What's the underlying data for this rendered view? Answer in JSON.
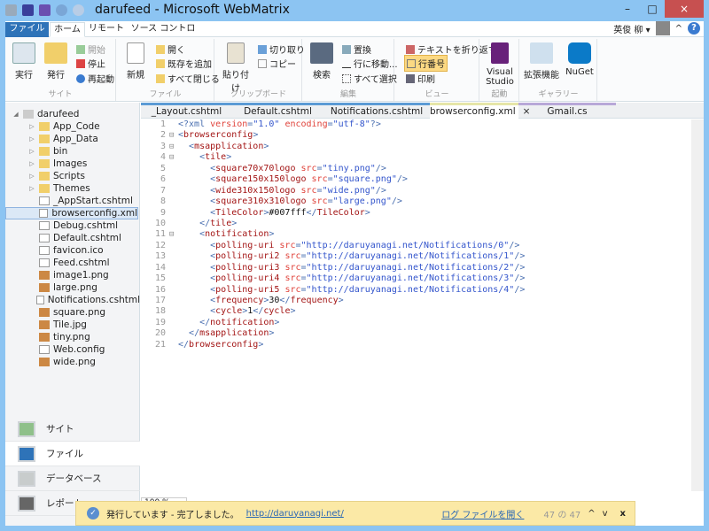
{
  "window": {
    "title": "darufeed - Microsoft WebMatrix",
    "minimize": "–",
    "maximize": "□",
    "close": "×"
  },
  "ribbon_tabs": [
    "ファイル",
    "ホーム",
    "リモート",
    "ソース コントロール"
  ],
  "user": {
    "name": "英俊 柳 ▾",
    "collapse": "^",
    "help": "?"
  },
  "ribbon": {
    "site": {
      "label": "サイト",
      "run": "実行",
      "publish": "発行",
      "start": "開始",
      "stop": "停止",
      "restart": "再起動"
    },
    "file": {
      "label": "ファイル",
      "new": "新規",
      "open": "開く",
      "add_existing": "既存を追加",
      "close_all": "すべて閉じる"
    },
    "clipboard": {
      "label": "クリップボード",
      "paste": "貼り付け",
      "cut": "切り取り",
      "copy": "コピー"
    },
    "edit": {
      "label": "編集",
      "find": "検索",
      "replace": "置換",
      "goto": "行に移動...",
      "select_all": "すべて選択"
    },
    "view": {
      "label": "ビュー",
      "wrap": "テキストを折り返す",
      "line_numbers": "行番号",
      "print": "印刷"
    },
    "launch": {
      "label": "起動",
      "vs": "Visual Studio"
    },
    "gallery": {
      "label": "ギャラリー",
      "extensions": "拡張機能",
      "nuget": "NuGet"
    }
  },
  "tree": [
    {
      "name": "darufeed",
      "type": "root"
    },
    {
      "name": "App_Code",
      "type": "folder"
    },
    {
      "name": "App_Data",
      "type": "folder"
    },
    {
      "name": "bin",
      "type": "folder"
    },
    {
      "name": "Images",
      "type": "folder"
    },
    {
      "name": "Scripts",
      "type": "folder"
    },
    {
      "name": "Themes",
      "type": "folder"
    },
    {
      "name": "_AppStart.cshtml",
      "type": "file"
    },
    {
      "name": "browserconfig.xml",
      "type": "file",
      "selected": true
    },
    {
      "name": "Debug.cshtml",
      "type": "file"
    },
    {
      "name": "Default.cshtml",
      "type": "file"
    },
    {
      "name": "favicon.ico",
      "type": "file"
    },
    {
      "name": "Feed.cshtml",
      "type": "file"
    },
    {
      "name": "image1.png",
      "type": "image"
    },
    {
      "name": "large.png",
      "type": "image"
    },
    {
      "name": "Notifications.cshtml",
      "type": "file"
    },
    {
      "name": "square.png",
      "type": "image"
    },
    {
      "name": "Tile.jpg",
      "type": "image"
    },
    {
      "name": "tiny.png",
      "type": "image"
    },
    {
      "name": "Web.config",
      "type": "file"
    },
    {
      "name": "wide.png",
      "type": "image"
    }
  ],
  "workspaces": [
    {
      "label": "サイト",
      "color": "#8fc08a"
    },
    {
      "label": "ファイル",
      "color": "#2e73b8",
      "active": true
    },
    {
      "label": "データベース",
      "color": "#c8cccc"
    },
    {
      "label": "レポート",
      "color": "#666"
    }
  ],
  "editor_tabs": [
    {
      "label": "_Layout.cshtml"
    },
    {
      "label": "Default.cshtml"
    },
    {
      "label": "Notifications.cshtml"
    },
    {
      "label": "browserconfig.xml",
      "active": true,
      "close": "×"
    },
    {
      "label": "Gmail.cs"
    }
  ],
  "code": [
    [
      [
        "b",
        "<?xml "
      ],
      [
        "a",
        "version"
      ],
      [
        "b",
        "="
      ],
      [
        "v",
        "\"1.0\" "
      ],
      [
        "a",
        "encoding"
      ],
      [
        "b",
        "="
      ],
      [
        "v",
        "\"utf-8\""
      ],
      [
        "b",
        "?>"
      ]
    ],
    [
      [
        "b",
        "<"
      ],
      [
        "t",
        "browserconfig"
      ],
      [
        "b",
        ">"
      ]
    ],
    [
      [
        "x",
        "  "
      ],
      [
        "b",
        "<"
      ],
      [
        "t",
        "msapplication"
      ],
      [
        "b",
        ">"
      ]
    ],
    [
      [
        "x",
        "    "
      ],
      [
        "b",
        "<"
      ],
      [
        "t",
        "tile"
      ],
      [
        "b",
        ">"
      ]
    ],
    [
      [
        "x",
        "      "
      ],
      [
        "b",
        "<"
      ],
      [
        "t",
        "square70x70logo "
      ],
      [
        "a",
        "src"
      ],
      [
        "b",
        "="
      ],
      [
        "v",
        "\"tiny.png\""
      ],
      [
        "b",
        "/>"
      ]
    ],
    [
      [
        "x",
        "      "
      ],
      [
        "b",
        "<"
      ],
      [
        "t",
        "square150x150logo "
      ],
      [
        "a",
        "src"
      ],
      [
        "b",
        "="
      ],
      [
        "v",
        "\"square.png\""
      ],
      [
        "b",
        "/>"
      ]
    ],
    [
      [
        "x",
        "      "
      ],
      [
        "b",
        "<"
      ],
      [
        "t",
        "wide310x150logo "
      ],
      [
        "a",
        "src"
      ],
      [
        "b",
        "="
      ],
      [
        "v",
        "\"wide.png\""
      ],
      [
        "b",
        "/>"
      ]
    ],
    [
      [
        "x",
        "      "
      ],
      [
        "b",
        "<"
      ],
      [
        "t",
        "square310x310logo "
      ],
      [
        "a",
        "src"
      ],
      [
        "b",
        "="
      ],
      [
        "v",
        "\"large.png\""
      ],
      [
        "b",
        "/>"
      ]
    ],
    [
      [
        "x",
        "      "
      ],
      [
        "b",
        "<"
      ],
      [
        "t",
        "TileColor"
      ],
      [
        "b",
        ">"
      ],
      [
        "x",
        "#007fff"
      ],
      [
        "b",
        "</"
      ],
      [
        "t",
        "TileColor"
      ],
      [
        "b",
        ">"
      ]
    ],
    [
      [
        "x",
        "    "
      ],
      [
        "b",
        "</"
      ],
      [
        "t",
        "tile"
      ],
      [
        "b",
        ">"
      ]
    ],
    [
      [
        "x",
        "    "
      ],
      [
        "b",
        "<"
      ],
      [
        "t",
        "notification"
      ],
      [
        "b",
        ">"
      ]
    ],
    [
      [
        "x",
        "      "
      ],
      [
        "b",
        "<"
      ],
      [
        "t",
        "polling-uri "
      ],
      [
        "a",
        "src"
      ],
      [
        "b",
        "="
      ],
      [
        "v",
        "\"http://daruyanagi.net/Notifications/0\""
      ],
      [
        "b",
        "/>"
      ]
    ],
    [
      [
        "x",
        "      "
      ],
      [
        "b",
        "<"
      ],
      [
        "t",
        "polling-uri2 "
      ],
      [
        "a",
        "src"
      ],
      [
        "b",
        "="
      ],
      [
        "v",
        "\"http://daruyanagi.net/Notifications/1\""
      ],
      [
        "b",
        "/>"
      ]
    ],
    [
      [
        "x",
        "      "
      ],
      [
        "b",
        "<"
      ],
      [
        "t",
        "polling-uri3 "
      ],
      [
        "a",
        "src"
      ],
      [
        "b",
        "="
      ],
      [
        "v",
        "\"http://daruyanagi.net/Notifications/2\""
      ],
      [
        "b",
        "/>"
      ]
    ],
    [
      [
        "x",
        "      "
      ],
      [
        "b",
        "<"
      ],
      [
        "t",
        "polling-uri4 "
      ],
      [
        "a",
        "src"
      ],
      [
        "b",
        "="
      ],
      [
        "v",
        "\"http://daruyanagi.net/Notifications/3\""
      ],
      [
        "b",
        "/>"
      ]
    ],
    [
      [
        "x",
        "      "
      ],
      [
        "b",
        "<"
      ],
      [
        "t",
        "polling-uri5 "
      ],
      [
        "a",
        "src"
      ],
      [
        "b",
        "="
      ],
      [
        "v",
        "\"http://daruyanagi.net/Notifications/4\""
      ],
      [
        "b",
        "/>"
      ]
    ],
    [
      [
        "x",
        "      "
      ],
      [
        "b",
        "<"
      ],
      [
        "t",
        "frequency"
      ],
      [
        "b",
        ">"
      ],
      [
        "x",
        "30"
      ],
      [
        "b",
        "</"
      ],
      [
        "t",
        "frequency"
      ],
      [
        "b",
        ">"
      ]
    ],
    [
      [
        "x",
        "      "
      ],
      [
        "b",
        "<"
      ],
      [
        "t",
        "cycle"
      ],
      [
        "b",
        ">"
      ],
      [
        "x",
        "1"
      ],
      [
        "b",
        "</"
      ],
      [
        "t",
        "cycle"
      ],
      [
        "b",
        ">"
      ]
    ],
    [
      [
        "x",
        "    "
      ],
      [
        "b",
        "</"
      ],
      [
        "t",
        "notification"
      ],
      [
        "b",
        ">"
      ]
    ],
    [
      [
        "x",
        "  "
      ],
      [
        "b",
        "</"
      ],
      [
        "t",
        "msapplication"
      ],
      [
        "b",
        ">"
      ]
    ],
    [
      [
        "b",
        "</"
      ],
      [
        "t",
        "browserconfig"
      ],
      [
        "b",
        ">"
      ]
    ]
  ],
  "fold_lines": [
    2,
    3,
    4,
    11
  ],
  "zoom": "100 %",
  "notification": {
    "message": "発行しています - 完了しました。",
    "url": "http://daruyanagi.net/",
    "log_link": "ログ ファイルを開く",
    "count": "47 の 47",
    "prev": "^",
    "next": "v",
    "close": "x"
  }
}
